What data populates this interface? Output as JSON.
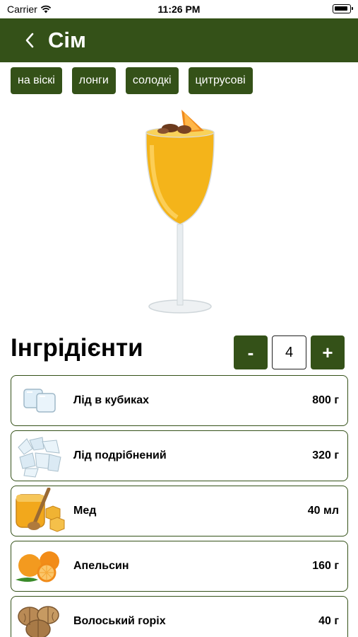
{
  "status": {
    "carrier": "Carrier",
    "time": "11:26 PM"
  },
  "nav": {
    "title": "Сім"
  },
  "tags": [
    "на віскі",
    "лонги",
    "солодкі",
    "цитрусові"
  ],
  "ingredients_section": {
    "title": "Інгрідієнти",
    "quantity": "4",
    "minus_label": "-",
    "plus_label": "+"
  },
  "ingredients": [
    {
      "name": "Лід в кубиках",
      "amount": "800 г",
      "icon": "ice-cubes-icon"
    },
    {
      "name": "Лід подрібнений",
      "amount": "320 г",
      "icon": "crushed-ice-icon"
    },
    {
      "name": "Мед",
      "amount": "40 мл",
      "icon": "honey-icon"
    },
    {
      "name": "Апельсин",
      "amount": "160 г",
      "icon": "orange-icon"
    },
    {
      "name": "Волоський горіх",
      "amount": "40 г",
      "icon": "walnut-icon"
    }
  ],
  "colors": {
    "accent": "#345118",
    "background": "#ffffff"
  }
}
